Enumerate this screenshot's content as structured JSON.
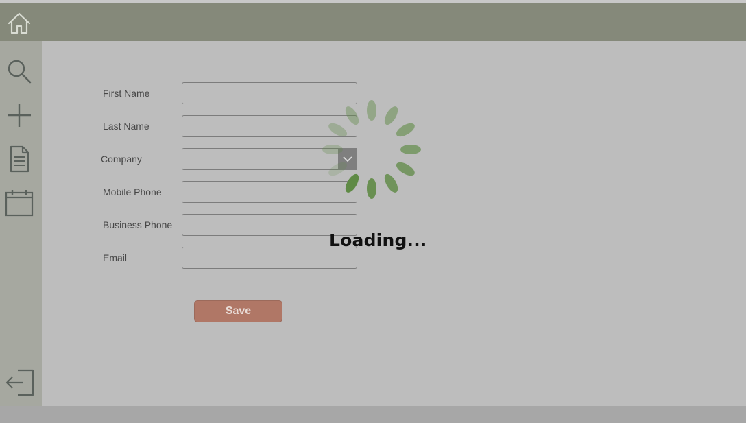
{
  "header": {
    "home_icon": "home-icon"
  },
  "sidebar": {
    "items": [
      {
        "icon": "search-icon"
      },
      {
        "icon": "plus-icon"
      },
      {
        "icon": "document-icon"
      },
      {
        "icon": "calendar-icon"
      }
    ],
    "exit_icon": "sign-out-icon"
  },
  "form": {
    "fields": [
      {
        "label": "First Name",
        "value": ""
      },
      {
        "label": "Last Name",
        "value": ""
      },
      {
        "label": "Company",
        "value": ""
      },
      {
        "label": "Mobile Phone",
        "value": ""
      },
      {
        "label": "Business Phone",
        "value": ""
      },
      {
        "label": "Email",
        "value": ""
      }
    ],
    "save_label": "Save"
  },
  "overlay": {
    "loading_text": "Loading..."
  },
  "colors": {
    "header": "#85897a",
    "sidebar": "#a6a8a0",
    "main": "#bdbdbd",
    "save_button": "#b07766",
    "spinner": "#5f8a45"
  }
}
